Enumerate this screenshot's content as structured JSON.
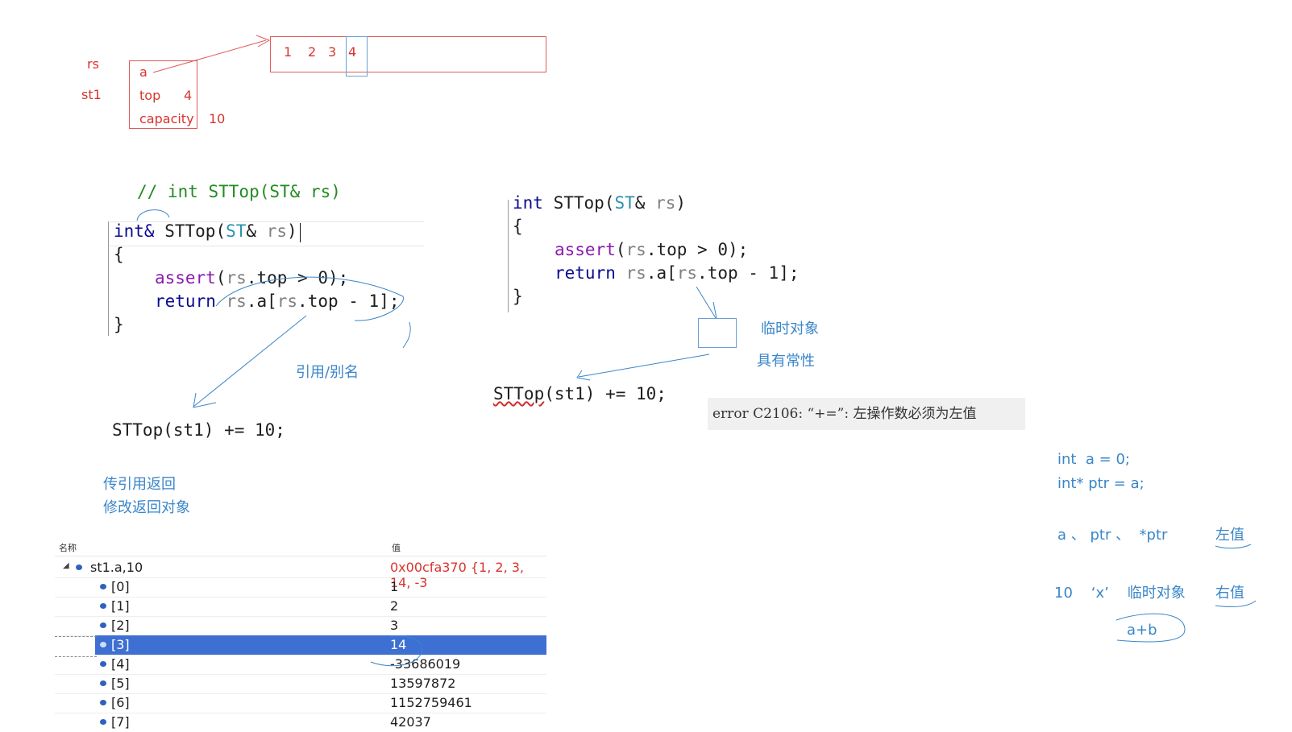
{
  "memory": {
    "rs": "rs",
    "st1": "st1",
    "fields": [
      "a",
      "top",
      "capacity"
    ],
    "top_value": "4",
    "capacity_value": "10",
    "array_cells": [
      "1",
      "2",
      "3",
      "4"
    ]
  },
  "left_code": {
    "comment": "// int STTop(ST& rs)",
    "sig_ret": "int&",
    "sig_name": "STTop",
    "sig_open": "(",
    "sig_type": "ST",
    "sig_amp": "&",
    "sig_param": "rs",
    "sig_close": ")",
    "open_brace": "{",
    "assert_kw": "assert",
    "assert_rest_a": "(",
    "assert_rs": "rs",
    "assert_rest_b": ".top > 0);",
    "return_kw": "return",
    "return_rs1": "rs",
    "return_mid": ".a[",
    "return_rs2": "rs",
    "return_end": ".top - 1];",
    "close_brace": "}",
    "call": "STTop(st1) += 10;"
  },
  "right_code": {
    "sig_ret": "int",
    "sig_name": "STTop",
    "sig_open": "(",
    "sig_type": "ST",
    "sig_amp": "&",
    "sig_param": "rs",
    "sig_close": ")",
    "open_brace": "{",
    "assert_kw": "assert",
    "assert_rest_a": "(",
    "assert_rs": "rs",
    "assert_rest_b": ".top > 0);",
    "return_kw": "return",
    "return_rs1": "rs",
    "return_mid": ".a[",
    "return_rs2": "rs",
    "return_end": ".top - 1];",
    "close_brace": "}",
    "call_name": "STTop",
    "call_rest": "(st1) += 10;"
  },
  "annotations": {
    "ref_alias": "引用/别名",
    "temp_obj": "临时对象",
    "const_prop": "具有常性",
    "pass_ref_return": "传引用返回",
    "modify_return": "修改返回对象"
  },
  "error": {
    "message": "error C2106: “+=”: 左操作数必须为左值"
  },
  "side_notes": {
    "line1": "int  a = 0;",
    "line2": "int* ptr = a;",
    "lvalues": "a 、 ptr 、  *ptr",
    "lvalue_label": "左值",
    "rvalues": "10    ‘x’    临时对象",
    "rvalue_label": "右值",
    "expr": "a+b"
  },
  "watch": {
    "col_name": "名称",
    "col_value": "值",
    "root_name": "st1.a,10",
    "root_value": "0x00cfa370 {1, 2, 3, 14, -3",
    "items": [
      {
        "name": "[0]",
        "value": "1"
      },
      {
        "name": "[1]",
        "value": "2"
      },
      {
        "name": "[2]",
        "value": "3"
      },
      {
        "name": "[3]",
        "value": "14"
      },
      {
        "name": "[4]",
        "value": "-33686019"
      },
      {
        "name": "[5]",
        "value": "13597872"
      },
      {
        "name": "[6]",
        "value": "1152759461"
      },
      {
        "name": "[7]",
        "value": "42037"
      }
    ],
    "selected_index": 3
  }
}
